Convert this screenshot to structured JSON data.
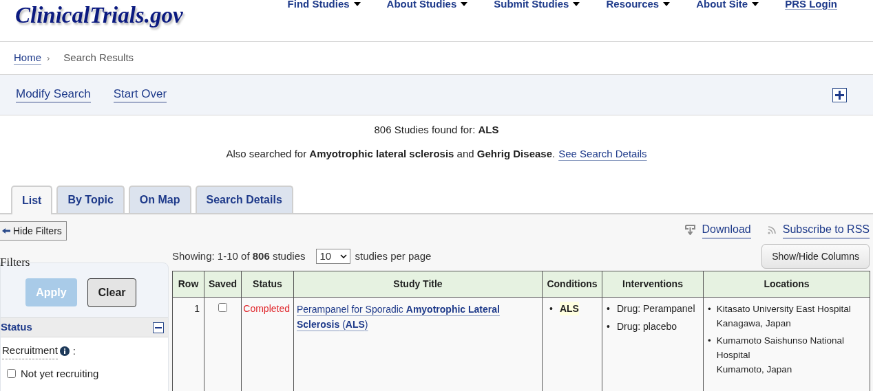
{
  "header": {
    "logo": "ClinicalTrials.gov",
    "nav": [
      {
        "label": "Find Studies",
        "dropdown": true
      },
      {
        "label": "About Studies",
        "dropdown": true
      },
      {
        "label": "Submit Studies",
        "dropdown": true
      },
      {
        "label": "Resources",
        "dropdown": true
      },
      {
        "label": "About Site",
        "dropdown": true
      },
      {
        "label": "PRS Login",
        "dropdown": false
      }
    ]
  },
  "breadcrumb": [
    {
      "label": "Home",
      "link": true,
      "separator": "›"
    },
    {
      "label": "Search Results",
      "link": false
    }
  ],
  "actions": [
    "Modify Search",
    "Start Over"
  ],
  "summary": {
    "count_line": "806 Studies found for: **ALS**",
    "also_line": "Also searched for **Amyotrophic lateral sclerosis** and **Gehrig Disease**.",
    "details_link": "See Search Details"
  },
  "tabs": [
    {
      "label": "List",
      "selected": true
    },
    {
      "label": "By Topic",
      "selected": false
    },
    {
      "label": "On Map",
      "selected": false
    },
    {
      "label": "Search Details",
      "selected": false
    }
  ],
  "toolbar": {
    "hide_filters": "Hide Filters",
    "download": "Download",
    "rss": "Subscribe to RSS",
    "show_hide": "Show/Hide Columns"
  },
  "showing": {
    "text": "Showing: 1-10 of **806** studies",
    "per_page": "10",
    "per_page_label": "studies per page"
  },
  "filters": {
    "title": "Filters",
    "apply": {
      "label": "Apply",
      "disabled": true
    },
    "clear": "Clear",
    "section": {
      "title": "Status",
      "expanded": true,
      "field": "Recruitment",
      "field_suffix": ":",
      "options": [
        {
          "label": "Not yet recruiting",
          "checked": false
        }
      ]
    }
  },
  "table": {
    "bullet": "•",
    "columns": [
      "Row",
      "Saved",
      "Status",
      "Study Title",
      "Conditions",
      "Interventions",
      "Locations"
    ],
    "rows": [
      {
        "row": "1",
        "saved": false,
        "status": "Completed",
        "title": "Perampanel for Sporadic **Amyotrophic Lateral Sclerosis** (**ALS**)",
        "conditions": [
          "ALS"
        ],
        "interventions": [
          "Drug: Perampanel",
          "Drug: placebo"
        ],
        "locations": [
          {
            "name": "Kitasato University East Hospital",
            "place": "Kanagawa, Japan"
          },
          {
            "name": "Kumamoto Saishunso National Hospital",
            "place": "Kumamoto, Japan"
          }
        ]
      }
    ]
  }
}
